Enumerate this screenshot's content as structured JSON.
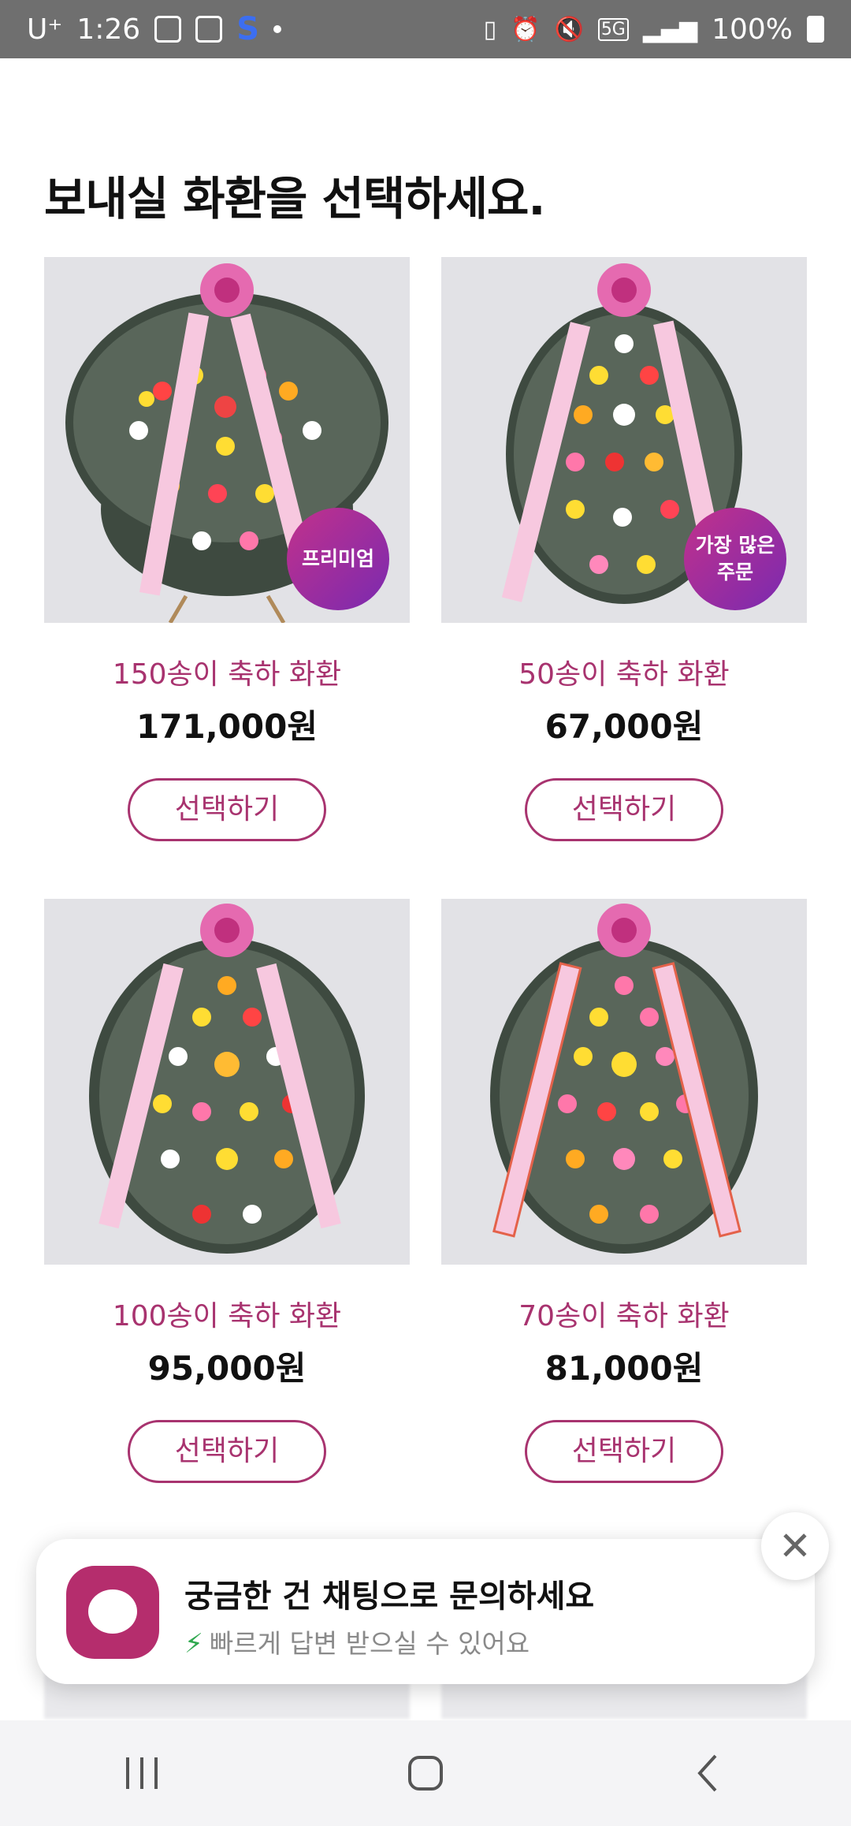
{
  "status": {
    "carrier": "U⁺",
    "time": "1:26",
    "network": "5G",
    "battery": "100%"
  },
  "page": {
    "title": "보내실 화환을 선택하세요."
  },
  "products": [
    {
      "name": "150송이 축하 화환",
      "price": "171,000원",
      "button": "선택하기",
      "badge": "프리미엄"
    },
    {
      "name": "50송이 축하 화환",
      "price": "67,000원",
      "button": "선택하기",
      "badge_line1": "가장 많은",
      "badge_line2": "주문"
    },
    {
      "name": "100송이 축하 화환",
      "price": "95,000원",
      "button": "선택하기"
    },
    {
      "name": "70송이 축하 화환",
      "price": "81,000원",
      "button": "선택하기"
    }
  ],
  "chat": {
    "title": "궁금한 건 채팅으로 문의하세요",
    "subtitle": "빠르게 답변 받으실 수 있어요",
    "close": "✕"
  },
  "nav": {
    "recent": "|||",
    "home": "◯",
    "back": "‹"
  },
  "colors": {
    "accent": "#a8336f",
    "badge_gradient_start": "#c2318b",
    "badge_gradient_end": "#7a2ab0",
    "chat_logo": "#b52d6d",
    "status_bar": "#6f6f6f"
  }
}
